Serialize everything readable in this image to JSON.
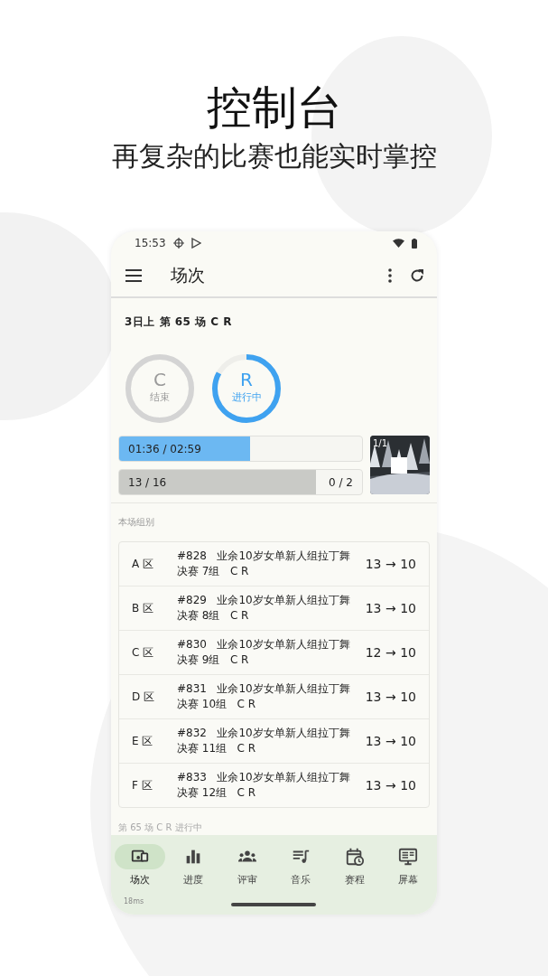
{
  "headline": "控制台",
  "subtitle": "再复杂的比赛也能实时掌控",
  "status_bar": {
    "time": "15:53"
  },
  "app_bar": {
    "title": "场次"
  },
  "session": {
    "title": "3日上 第 65 场 C R",
    "rounds": [
      {
        "kind": "finished",
        "letter": "C",
        "status": "结束"
      },
      {
        "kind": "active",
        "letter": "R",
        "status": "进行中",
        "level": 0.83
      }
    ],
    "time_progress": {
      "label": "01:36 / 02:59",
      "level": 0.54
    },
    "count_progress": {
      "label": "13 / 16",
      "extra": "0 / 2",
      "level": 0.81
    },
    "preview": {
      "kind": "picture",
      "counter": "1/1"
    }
  },
  "groups": {
    "heading": "本场组别",
    "rows": [
      {
        "zone": "A 区",
        "description": "#828   业余10岁女单新人组拉丁舞决赛 7组   C R",
        "from": "13",
        "arrow": "→",
        "to": "10"
      },
      {
        "zone": "B 区",
        "description": "#829   业余10岁女单新人组拉丁舞决赛 8组   C R",
        "from": "13",
        "arrow": "→",
        "to": "10"
      },
      {
        "zone": "C 区",
        "description": "#830   业余10岁女单新人组拉丁舞决赛 9组   C R",
        "from": "12",
        "arrow": "→",
        "to": "10"
      },
      {
        "zone": "D 区",
        "description": "#831   业余10岁女单新人组拉丁舞决赛 10组   C R",
        "from": "13",
        "arrow": "→",
        "to": "10"
      },
      {
        "zone": "E 区",
        "description": "#832   业余10岁女单新人组拉丁舞决赛 11组   C R",
        "from": "13",
        "arrow": "→",
        "to": "10"
      },
      {
        "zone": "F 区",
        "description": "#833   业余10岁女单新人组拉丁舞决赛 12组   C R",
        "from": "13",
        "arrow": "→",
        "to": "10"
      }
    ],
    "footer": "第 65 场  C R 进行中"
  },
  "nav": [
    {
      "label": "场次",
      "kind": "session",
      "selected": true
    },
    {
      "label": "进度",
      "kind": "chart",
      "selected": false
    },
    {
      "label": "评审",
      "kind": "people",
      "selected": false
    },
    {
      "label": "音乐",
      "kind": "music",
      "selected": false
    },
    {
      "label": "赛程",
      "kind": "calendar",
      "selected": false
    },
    {
      "label": "屏幕",
      "kind": "screen",
      "selected": false
    }
  ],
  "latency": "18ms"
}
